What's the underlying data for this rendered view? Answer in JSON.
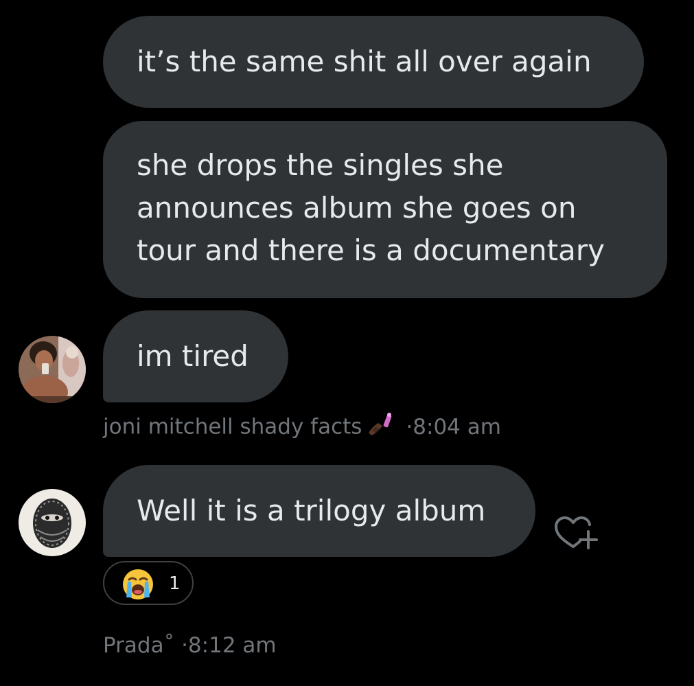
{
  "messages": [
    {
      "text": "it’s the same shit all over again"
    },
    {
      "lines": [
        "she drops the singles she",
        "announces album she goes on",
        "tour and there is a documentary"
      ]
    },
    {
      "text": "im tired"
    },
    {
      "text": "Well it is a trilogy album"
    }
  ],
  "senders": {
    "first": {
      "name": "joni mitchell shady facts",
      "emoji": "nail-polish-icon",
      "time": "·8:04 am"
    },
    "second": {
      "name": "Prada˚",
      "time": "·8:12 am"
    }
  },
  "reactions": [
    {
      "emoji": "loudly-crying-face-icon",
      "count": "1"
    }
  ],
  "colors": {
    "background": "#000000",
    "bubble": "#2f3336",
    "text": "#e7e9ea",
    "muted": "#71767b"
  }
}
